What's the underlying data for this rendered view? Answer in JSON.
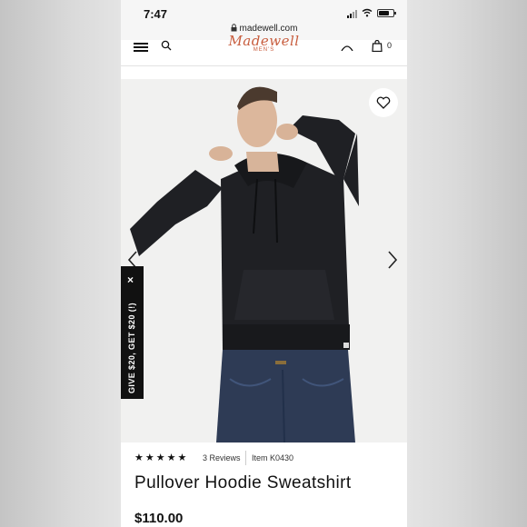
{
  "status_bar": {
    "time": "7:47",
    "battery_level": 0.7
  },
  "browser": {
    "url": "madewell.com"
  },
  "site_header": {
    "logo_script": "Madewell",
    "logo_sub": "MEN'S",
    "bag_count": "0"
  },
  "promo": {
    "close_glyph": "×",
    "text": "GIVE $20, GET $20 (!)"
  },
  "product": {
    "rating_stars": 5,
    "reviews_label": "3 Reviews",
    "item_label": "Item K0430",
    "title": "Pullover Hoodie Sweatshirt",
    "price": "$110.00"
  },
  "colors": {
    "logo": "#c85d3e",
    "hoodie": "#1f2024",
    "jeans": "#2e3b55",
    "promo_bg": "#111111"
  }
}
